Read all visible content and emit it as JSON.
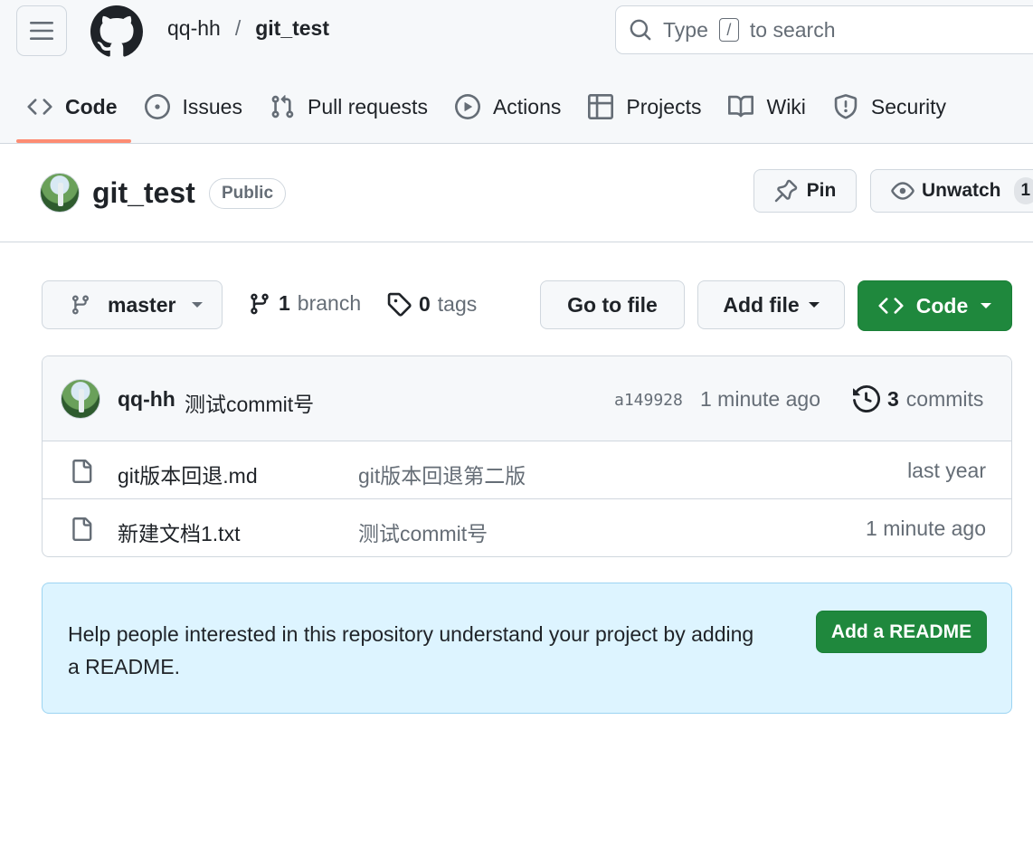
{
  "header": {
    "owner": "qq-hh",
    "separator": "/",
    "repo": "git_test",
    "search": {
      "prefix": "Type",
      "key": "/",
      "suffix": "to search"
    }
  },
  "tabs": [
    {
      "label": "Code",
      "icon": "code-icon",
      "active": true
    },
    {
      "label": "Issues",
      "icon": "issue-opened-icon"
    },
    {
      "label": "Pull requests",
      "icon": "git-pull-request-icon"
    },
    {
      "label": "Actions",
      "icon": "play-icon"
    },
    {
      "label": "Projects",
      "icon": "table-icon"
    },
    {
      "label": "Wiki",
      "icon": "book-icon"
    },
    {
      "label": "Security",
      "icon": "shield-icon"
    }
  ],
  "repo_header": {
    "name": "git_test",
    "visibility": "Public",
    "pin_label": "Pin",
    "watch_label": "Unwatch",
    "watch_count": "1"
  },
  "branch_bar": {
    "branch": "master",
    "branch_count": "1",
    "branch_word": "branch",
    "tag_count": "0",
    "tag_word": "tags",
    "go_to_file": "Go to file",
    "add_file": "Add file",
    "code": "Code"
  },
  "latest_commit": {
    "author": "qq-hh",
    "message": "测试commit号",
    "sha": "a149928",
    "time": "1 minute ago",
    "count": "3",
    "count_word": "commits"
  },
  "files": [
    {
      "name": "git版本回退.md",
      "message": "git版本回退第二版",
      "time": "last year"
    },
    {
      "name": "新建文档1.txt",
      "message": "测试commit号",
      "time": "1 minute ago"
    }
  ],
  "readme_banner": {
    "text": "Help people interested in this repository understand your project by adding a README.",
    "button": "Add a README"
  },
  "colors": {
    "accent_green": "#1f883d",
    "tab_underline": "#fd8c73",
    "banner_bg": "#ddf4ff"
  }
}
